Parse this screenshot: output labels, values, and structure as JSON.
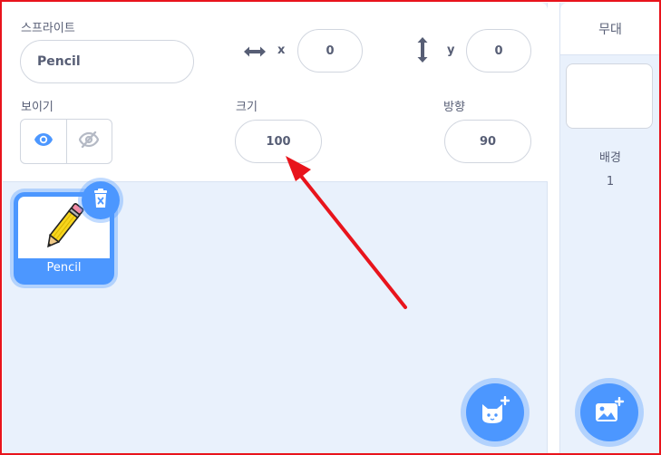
{
  "sprite_info": {
    "sprite_label": "스프라이트",
    "sprite_name": "Pencil",
    "x_label": "x",
    "x_value": "0",
    "y_label": "y",
    "y_value": "0",
    "show_label": "보이기",
    "size_label": "크기",
    "size_value": "100",
    "direction_label": "방향",
    "direction_value": "90"
  },
  "sprites": [
    {
      "name": "Pencil",
      "selected": true
    }
  ],
  "stage": {
    "title": "무대",
    "backdrop_label": "배경",
    "backdrop_count": "1"
  },
  "icons": {
    "x_arrow": "horizontal-arrows-icon",
    "y_arrow": "vertical-arrows-icon",
    "show": "eye-icon",
    "hide": "eye-slash-icon",
    "delete": "trash-icon",
    "add_sprite": "cat-plus-icon",
    "add_backdrop": "image-plus-icon"
  },
  "colors": {
    "accent": "#4c97ff",
    "annotation": "#e8141c",
    "text": "#575e75",
    "pane_bg": "#e9f1fc"
  }
}
